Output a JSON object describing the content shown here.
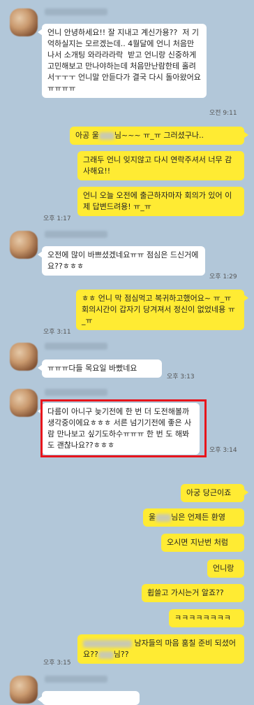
{
  "messages": {
    "m1": "언니 안녕하세요!! 잘 지내고 계신가용??  저 기억하실지는 모르겠는데.. 4월달에 언니 처음만나서 소개팅 와라라라락  받고 언니랑 신중하게 고민해보고 만나야하는데 처음만난람한테 홀려서ㅜㅜㅜ 언니말 안듣다가 결국 다시 돌아왔어요ㅠㅠㅠㅠ",
    "t1": "오전 9:11",
    "m2a": "아공 울",
    "m2b": "님~~~ ㅠ_ㅠ 그러셨구나..",
    "m3": "그래두 언니 잊지않고 다시 연락주셔서 너무 감사해요!!",
    "m4": "언니 오늘 오전에 출근하자마자 회의가 있어 이제 답변드려용! ㅠ_ㅠ",
    "t4": "오후 1:17",
    "m5": "오전에 많이 바쁘셨겠네요ㅠㅠ 점심은 드신거에요??ㅎㅎㅎ",
    "t5": "오후 1:29",
    "m6": "ㅎㅎ 언니 막 점심먹고 복귀하고했어요~ ㅠ_ㅠ 회의시간이 갑자기 당겨져서 정신이 없었네용 ㅠ_ㅠ",
    "t6": "오후 3:11",
    "m7": "ㅠㅠㅠ다들 목요일 바빴네요",
    "t7": "오후 3:13",
    "m8": "다름이 아니구 늦기전에 한 번 더 도전해볼까 생각중이에요ㅎㅎㅎ 서른 넘기기전에 좋은 사람 만나보고 싶기도하수ㅠㅠㅠ 한 번 도 해봐도 괜찮나요??ㅎㅎㅎ",
    "t8": "오후 3:14",
    "m9": "아궁 당근이죠",
    "m10a": "울",
    "m10b": "님은 언제든 환영",
    "m11": "오시면 지난번 처럼",
    "m12": "언니랑",
    "m13": "휩쓸고 가시는거 알죠??",
    "m14": "ㅋㅋㅋㅋㅋㅋㅋㅋ",
    "m15a": "남자들의 마음 훔칠 준비 되셨어요??",
    "m15b": "님??",
    "t15": "오후 3:15"
  }
}
